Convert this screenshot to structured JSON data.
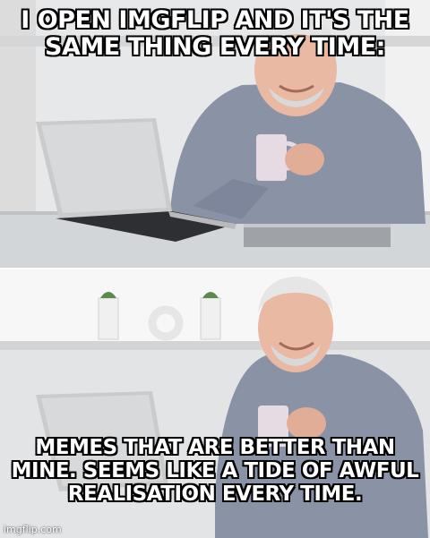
{
  "meme": {
    "top_text": "I OPEN IMGFLIP AND IT'S THE SAME THING EVERY TIME:",
    "bottom_text": "MEMES THAT ARE BETTER THAN MINE. SEEMS LIKE A TIDE OF AWFUL REALISATION EVERY TIME.",
    "watermark": "imgflip.com"
  },
  "colors": {
    "shirt": "#8a93a6",
    "skin": "#e9b9a4",
    "laptop": "#c9cbcd",
    "mug": "#e7dbe3",
    "background": "#e9eaeb"
  }
}
